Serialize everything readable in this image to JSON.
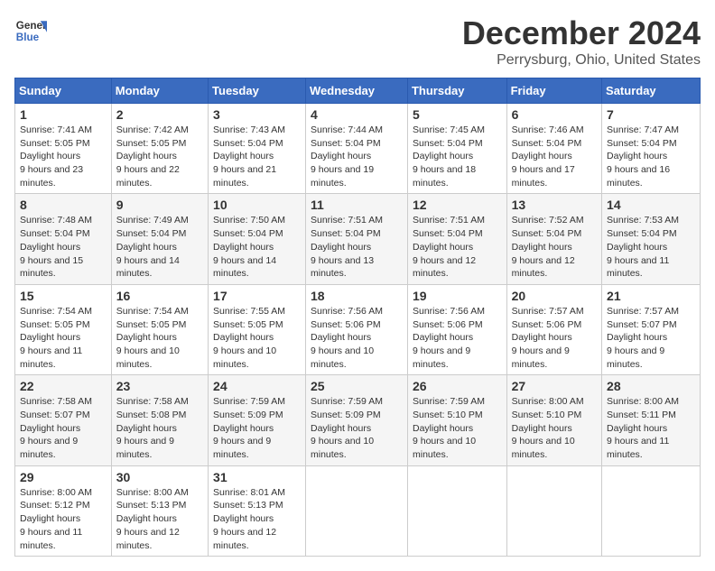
{
  "header": {
    "logo_line1": "General",
    "logo_line2": "Blue",
    "month": "December 2024",
    "location": "Perrysburg, Ohio, United States"
  },
  "weekdays": [
    "Sunday",
    "Monday",
    "Tuesday",
    "Wednesday",
    "Thursday",
    "Friday",
    "Saturday"
  ],
  "weeks": [
    [
      {
        "day": "1",
        "sunrise": "7:41 AM",
        "sunset": "5:05 PM",
        "daylight": "9 hours and 23 minutes."
      },
      {
        "day": "2",
        "sunrise": "7:42 AM",
        "sunset": "5:05 PM",
        "daylight": "9 hours and 22 minutes."
      },
      {
        "day": "3",
        "sunrise": "7:43 AM",
        "sunset": "5:04 PM",
        "daylight": "9 hours and 21 minutes."
      },
      {
        "day": "4",
        "sunrise": "7:44 AM",
        "sunset": "5:04 PM",
        "daylight": "9 hours and 19 minutes."
      },
      {
        "day": "5",
        "sunrise": "7:45 AM",
        "sunset": "5:04 PM",
        "daylight": "9 hours and 18 minutes."
      },
      {
        "day": "6",
        "sunrise": "7:46 AM",
        "sunset": "5:04 PM",
        "daylight": "9 hours and 17 minutes."
      },
      {
        "day": "7",
        "sunrise": "7:47 AM",
        "sunset": "5:04 PM",
        "daylight": "9 hours and 16 minutes."
      }
    ],
    [
      {
        "day": "8",
        "sunrise": "7:48 AM",
        "sunset": "5:04 PM",
        "daylight": "9 hours and 15 minutes."
      },
      {
        "day": "9",
        "sunrise": "7:49 AM",
        "sunset": "5:04 PM",
        "daylight": "9 hours and 14 minutes."
      },
      {
        "day": "10",
        "sunrise": "7:50 AM",
        "sunset": "5:04 PM",
        "daylight": "9 hours and 14 minutes."
      },
      {
        "day": "11",
        "sunrise": "7:51 AM",
        "sunset": "5:04 PM",
        "daylight": "9 hours and 13 minutes."
      },
      {
        "day": "12",
        "sunrise": "7:51 AM",
        "sunset": "5:04 PM",
        "daylight": "9 hours and 12 minutes."
      },
      {
        "day": "13",
        "sunrise": "7:52 AM",
        "sunset": "5:04 PM",
        "daylight": "9 hours and 12 minutes."
      },
      {
        "day": "14",
        "sunrise": "7:53 AM",
        "sunset": "5:04 PM",
        "daylight": "9 hours and 11 minutes."
      }
    ],
    [
      {
        "day": "15",
        "sunrise": "7:54 AM",
        "sunset": "5:05 PM",
        "daylight": "9 hours and 11 minutes."
      },
      {
        "day": "16",
        "sunrise": "7:54 AM",
        "sunset": "5:05 PM",
        "daylight": "9 hours and 10 minutes."
      },
      {
        "day": "17",
        "sunrise": "7:55 AM",
        "sunset": "5:05 PM",
        "daylight": "9 hours and 10 minutes."
      },
      {
        "day": "18",
        "sunrise": "7:56 AM",
        "sunset": "5:06 PM",
        "daylight": "9 hours and 10 minutes."
      },
      {
        "day": "19",
        "sunrise": "7:56 AM",
        "sunset": "5:06 PM",
        "daylight": "9 hours and 9 minutes."
      },
      {
        "day": "20",
        "sunrise": "7:57 AM",
        "sunset": "5:06 PM",
        "daylight": "9 hours and 9 minutes."
      },
      {
        "day": "21",
        "sunrise": "7:57 AM",
        "sunset": "5:07 PM",
        "daylight": "9 hours and 9 minutes."
      }
    ],
    [
      {
        "day": "22",
        "sunrise": "7:58 AM",
        "sunset": "5:07 PM",
        "daylight": "9 hours and 9 minutes."
      },
      {
        "day": "23",
        "sunrise": "7:58 AM",
        "sunset": "5:08 PM",
        "daylight": "9 hours and 9 minutes."
      },
      {
        "day": "24",
        "sunrise": "7:59 AM",
        "sunset": "5:09 PM",
        "daylight": "9 hours and 9 minutes."
      },
      {
        "day": "25",
        "sunrise": "7:59 AM",
        "sunset": "5:09 PM",
        "daylight": "9 hours and 10 minutes."
      },
      {
        "day": "26",
        "sunrise": "7:59 AM",
        "sunset": "5:10 PM",
        "daylight": "9 hours and 10 minutes."
      },
      {
        "day": "27",
        "sunrise": "8:00 AM",
        "sunset": "5:10 PM",
        "daylight": "9 hours and 10 minutes."
      },
      {
        "day": "28",
        "sunrise": "8:00 AM",
        "sunset": "5:11 PM",
        "daylight": "9 hours and 11 minutes."
      }
    ],
    [
      {
        "day": "29",
        "sunrise": "8:00 AM",
        "sunset": "5:12 PM",
        "daylight": "9 hours and 11 minutes."
      },
      {
        "day": "30",
        "sunrise": "8:00 AM",
        "sunset": "5:13 PM",
        "daylight": "9 hours and 12 minutes."
      },
      {
        "day": "31",
        "sunrise": "8:01 AM",
        "sunset": "5:13 PM",
        "daylight": "9 hours and 12 minutes."
      },
      null,
      null,
      null,
      null
    ]
  ]
}
